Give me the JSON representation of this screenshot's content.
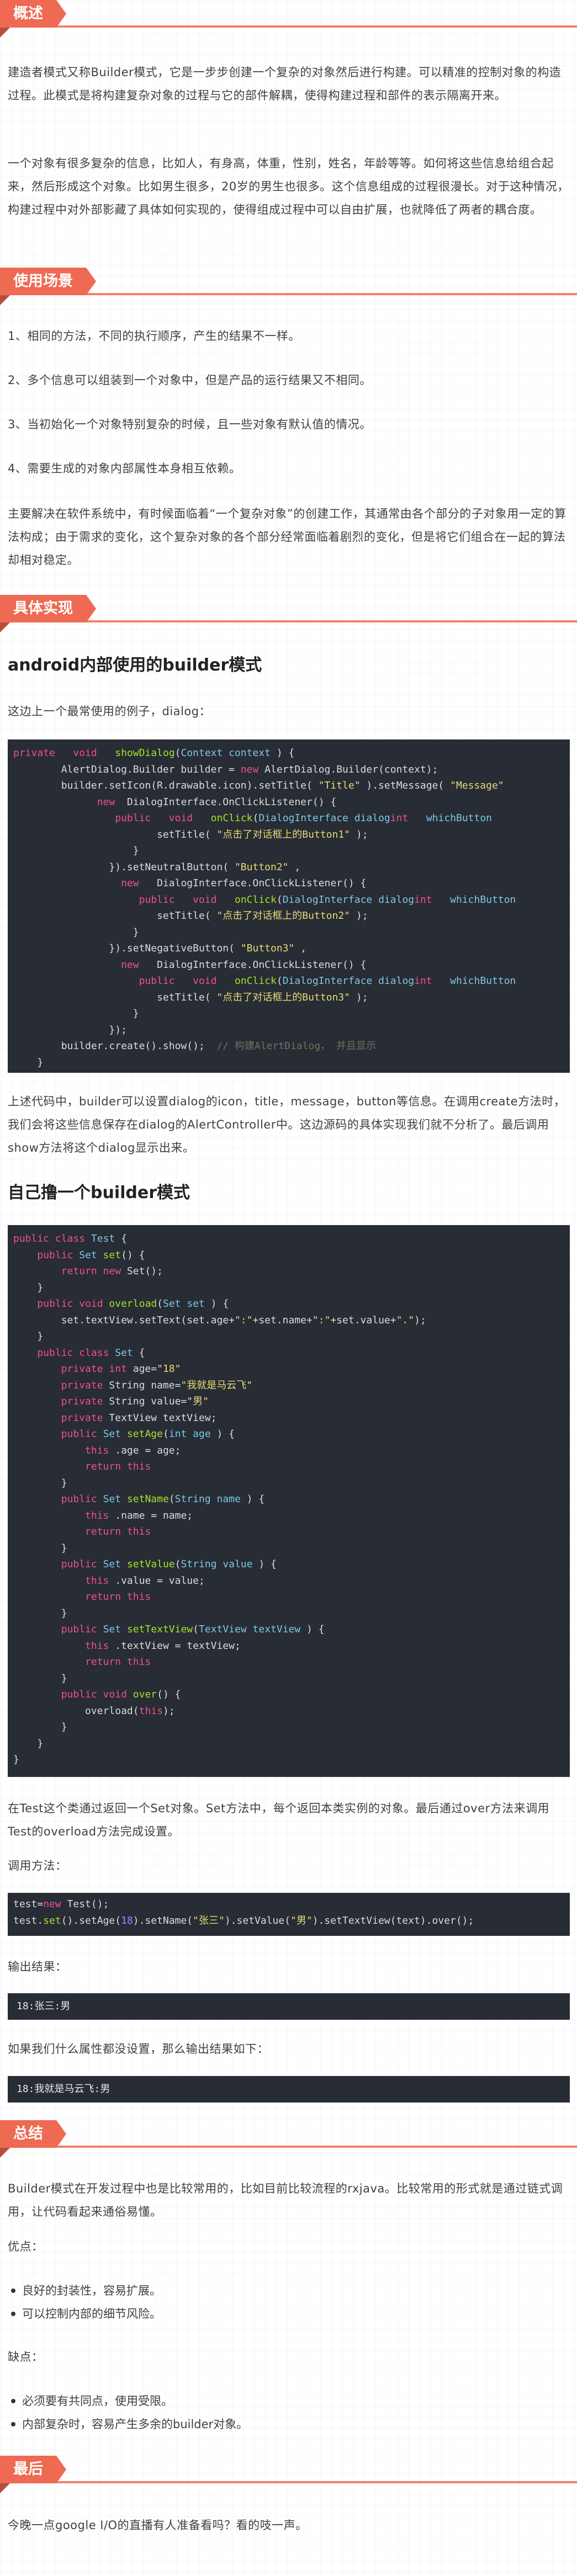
{
  "sections": {
    "overview": "概述",
    "scenarios": "使用场景",
    "impl": "具体实现",
    "summary": "总结",
    "last": "最后"
  },
  "overview": {
    "p1": "建造者模式又称Builder模式，它是一步步创建一个复杂的对象然后进行构建。可以精准的控制对象的构造过程。此模式是将构建复杂对象的过程与它的部件解耦，使得构建过程和部件的表示隔离开来。",
    "p2": "一个对象有很多复杂的信息，比如人，有身高，体重，性别，姓名，年龄等等。如何将这些信息给组合起来，然后形成这个对象。比如男生很多，20岁的男生也很多。这个信息组成的过程很漫长。对于这种情况，构建过程中对外部影藏了具体如何实现的，使得组成过程中可以自由扩展，也就降低了两者的耦合度。"
  },
  "scenarios": {
    "items": [
      "1、相同的方法，不同的执行顺序，产生的结果不一样。",
      "2、多个信息可以组装到一个对象中，但是产品的运行结果又不相同。",
      "3、当初始化一个对象特别复杂的时候，且一些对象有默认值的情况。",
      "4、需要生成的对象内部属性本身相互依赖。"
    ],
    "p": "主要解决在软件系统中，有时候面临着“一个复杂对象”的创建工作，其通常由各个部分的子对象用一定的算法构成；由于需求的变化，这个复杂对象的各个部分经常面临着剧烈的变化，但是将它们组合在一起的算法却相对稳定。"
  },
  "impl": {
    "h1": "android内部使用的builder模式",
    "p1": "这边上一个最常使用的例子，dialog：",
    "code1": [
      [
        [
          "k",
          "private"
        ],
        [
          "",
          "   "
        ],
        [
          "k",
          "void"
        ],
        [
          "",
          "   "
        ],
        [
          "f",
          "showDialog"
        ],
        [
          "",
          "("
        ],
        [
          "t",
          "Context context"
        ],
        [
          "",
          " ) {"
        ]
      ],
      [
        [
          "",
          "        AlertDialog.Builder builder = "
        ],
        [
          "k",
          "new"
        ],
        [
          "",
          " AlertDialog.Builder(context);"
        ]
      ],
      [
        [
          "",
          "        builder.setIcon(R.drawable.icon).setTitle( "
        ],
        [
          "s",
          "\"Title\""
        ],
        [
          "",
          " ).setMessage( "
        ],
        [
          "s",
          "\"Message\""
        ]
      ],
      [
        [
          "",
          "              "
        ],
        [
          "k",
          "new"
        ],
        [
          "",
          "  DialogInterface.OnClickListener() {"
        ]
      ],
      [
        [
          "",
          "                 "
        ],
        [
          "k",
          "public"
        ],
        [
          "",
          "   "
        ],
        [
          "k",
          "void"
        ],
        [
          "",
          "   "
        ],
        [
          "f",
          "onClick"
        ],
        [
          "",
          "("
        ],
        [
          "t",
          "DialogInterface dialog"
        ],
        [
          ",   "
        ],
        [
          "k",
          "int"
        ],
        [
          "",
          "   "
        ],
        [
          "t",
          "whichButton"
        ]
      ],
      [
        [
          "",
          "                        setTitle( "
        ],
        [
          "s",
          "\"点击了对话框上的Button1\""
        ],
        [
          "",
          " );"
        ]
      ],
      [
        [
          "",
          "                    }"
        ]
      ],
      [
        [
          "",
          "                }).setNeutralButton( "
        ],
        [
          "s",
          "\"Button2\""
        ],
        [
          "",
          " ,"
        ]
      ],
      [
        [
          "",
          "                  "
        ],
        [
          "k",
          "new"
        ],
        [
          "",
          "   DialogInterface.OnClickListener() {"
        ]
      ],
      [
        [
          "",
          "                     "
        ],
        [
          "k",
          "public"
        ],
        [
          "",
          "   "
        ],
        [
          "k",
          "void"
        ],
        [
          "",
          "   "
        ],
        [
          "f",
          "onClick"
        ],
        [
          "",
          "("
        ],
        [
          "t",
          "DialogInterface dialog"
        ],
        [
          ",   "
        ],
        [
          "k",
          "int"
        ],
        [
          "",
          "   "
        ],
        [
          "t",
          "whichButton"
        ]
      ],
      [
        [
          "",
          "                        setTitle( "
        ],
        [
          "s",
          "\"点击了对话框上的Button2\""
        ],
        [
          "",
          " );"
        ]
      ],
      [
        [
          "",
          "                    }"
        ]
      ],
      [
        [
          "",
          "                }).setNegativeButton( "
        ],
        [
          "s",
          "\"Button3\""
        ],
        [
          "",
          " ,"
        ]
      ],
      [
        [
          "",
          "                  "
        ],
        [
          "k",
          "new"
        ],
        [
          "",
          "   DialogInterface.OnClickListener() {"
        ]
      ],
      [
        [
          "",
          "                     "
        ],
        [
          "k",
          "public"
        ],
        [
          "",
          "   "
        ],
        [
          "k",
          "void"
        ],
        [
          "",
          "   "
        ],
        [
          "f",
          "onClick"
        ],
        [
          "",
          "("
        ],
        [
          "t",
          "DialogInterface dialog"
        ],
        [
          ",   "
        ],
        [
          "k",
          "int"
        ],
        [
          "",
          "   "
        ],
        [
          "t",
          "whichButton"
        ]
      ],
      [
        [
          "",
          "                        setTitle( "
        ],
        [
          "s",
          "\"点击了对话框上的Button3\""
        ],
        [
          "",
          " );"
        ]
      ],
      [
        [
          "",
          "                    }"
        ]
      ],
      [
        [
          "",
          "                });"
        ]
      ],
      [
        [
          "",
          "        builder.create().show();  "
        ],
        [
          "c",
          "// 构建AlertDialog， 并且显示"
        ]
      ],
      [
        [
          "",
          "    }"
        ]
      ]
    ],
    "p2": "上述代码中，builder可以设置dialog的icon，title，message，button等信息。在调用create方法时，我们会将这些信息保存在dialog的AlertController中。这边源码的具体实现我们就不分析了。最后调用show方法将这个dialog显示出来。",
    "h2": "自己撸一个builder模式",
    "code2": [
      [
        [
          "k",
          "public class"
        ],
        [
          "",
          " "
        ],
        [
          "t",
          "Test"
        ],
        [
          "",
          " {"
        ]
      ],
      [
        [
          "",
          "    "
        ],
        [
          "k",
          "public"
        ],
        [
          "",
          " "
        ],
        [
          "t",
          "Set"
        ],
        [
          "",
          " "
        ],
        [
          "f",
          "set"
        ],
        [
          "",
          "() {"
        ]
      ],
      [
        [
          "",
          "        "
        ],
        [
          "k",
          "return new"
        ],
        [
          "",
          " Set();"
        ]
      ],
      [
        [
          "",
          "    }"
        ]
      ],
      [
        [
          "",
          "    "
        ],
        [
          "k",
          "public void"
        ],
        [
          "",
          " "
        ],
        [
          "f",
          "overload"
        ],
        [
          "",
          "("
        ],
        [
          "t",
          "Set set"
        ],
        [
          "",
          " ) {"
        ]
      ],
      [
        [
          "",
          "        set.textView.setText(set.age+"
        ],
        [
          "s",
          "\":\""
        ],
        [
          "",
          "+set.name+"
        ],
        [
          "s",
          "\":\""
        ],
        [
          "",
          "+set.value+"
        ],
        [
          "s",
          "\".\""
        ],
        [
          "",
          ");"
        ]
      ],
      [
        [
          "",
          "    }"
        ]
      ],
      [
        [
          "",
          "    "
        ],
        [
          "k",
          "public class"
        ],
        [
          "",
          " "
        ],
        [
          "t",
          "Set"
        ],
        [
          "",
          " {"
        ]
      ],
      [
        [
          "",
          "        "
        ],
        [
          "k",
          "private int"
        ],
        [
          "",
          " age="
        ],
        [
          "s",
          "\"18\""
        ],
        [
          ";"
        ]
      ],
      [
        [
          "",
          "        "
        ],
        [
          "k",
          "private"
        ],
        [
          "",
          " String name="
        ],
        [
          "s",
          "\"我就是马云飞\""
        ],
        [
          ";"
        ]
      ],
      [
        [
          "",
          "        "
        ],
        [
          "k",
          "private"
        ],
        [
          "",
          " String value="
        ],
        [
          "s",
          "\"男\""
        ],
        [
          ";"
        ]
      ],
      [
        [
          "",
          "        "
        ],
        [
          "k",
          "private"
        ],
        [
          "",
          " TextView textView;"
        ]
      ],
      [
        [
          "",
          "        "
        ],
        [
          "k",
          "public"
        ],
        [
          "",
          " "
        ],
        [
          "t",
          "Set"
        ],
        [
          "",
          " "
        ],
        [
          "f",
          "setAge"
        ],
        [
          "",
          "("
        ],
        [
          "t",
          "int age"
        ],
        [
          "",
          " ) {"
        ]
      ],
      [
        [
          "",
          "            "
        ],
        [
          "k",
          "this"
        ],
        [
          "",
          " .age = age;"
        ]
      ],
      [
        [
          "",
          "            "
        ],
        [
          "k",
          "return this"
        ],
        [
          ";"
        ]
      ],
      [
        [
          "",
          "        }"
        ]
      ],
      [
        [
          "",
          "        "
        ],
        [
          "k",
          "public"
        ],
        [
          "",
          " "
        ],
        [
          "t",
          "Set"
        ],
        [
          "",
          " "
        ],
        [
          "f",
          "setName"
        ],
        [
          "",
          "("
        ],
        [
          "t",
          "String name"
        ],
        [
          "",
          " ) {"
        ]
      ],
      [
        [
          "",
          "            "
        ],
        [
          "k",
          "this"
        ],
        [
          "",
          " .name = name;"
        ]
      ],
      [
        [
          "",
          "            "
        ],
        [
          "k",
          "return this"
        ],
        [
          ";"
        ]
      ],
      [
        [
          "",
          "        }"
        ]
      ],
      [
        [
          "",
          "        "
        ],
        [
          "k",
          "public"
        ],
        [
          "",
          " "
        ],
        [
          "t",
          "Set"
        ],
        [
          "",
          " "
        ],
        [
          "f",
          "setValue"
        ],
        [
          "",
          "("
        ],
        [
          "t",
          "String value"
        ],
        [
          "",
          " ) {"
        ]
      ],
      [
        [
          "",
          "            "
        ],
        [
          "k",
          "this"
        ],
        [
          "",
          " .value = value;"
        ]
      ],
      [
        [
          "",
          "            "
        ],
        [
          "k",
          "return this"
        ],
        [
          ";"
        ]
      ],
      [
        [
          "",
          "        }"
        ]
      ],
      [
        [
          "",
          "        "
        ],
        [
          "k",
          "public"
        ],
        [
          "",
          " "
        ],
        [
          "t",
          "Set"
        ],
        [
          "",
          " "
        ],
        [
          "f",
          "setTextView"
        ],
        [
          "",
          "("
        ],
        [
          "t",
          "TextView textView"
        ],
        [
          "",
          " ) {"
        ]
      ],
      [
        [
          "",
          "            "
        ],
        [
          "k",
          "this"
        ],
        [
          "",
          " .textView = textView;"
        ]
      ],
      [
        [
          "",
          "            "
        ],
        [
          "k",
          "return this"
        ],
        [
          ";"
        ]
      ],
      [
        [
          "",
          "        }"
        ]
      ],
      [
        [
          "",
          "        "
        ],
        [
          "k",
          "public void"
        ],
        [
          "",
          " "
        ],
        [
          "f",
          "over"
        ],
        [
          "",
          "() {"
        ]
      ],
      [
        [
          "",
          "            overload("
        ],
        [
          "k",
          "this"
        ],
        [
          "",
          ");"
        ]
      ],
      [
        [
          "",
          "        }"
        ]
      ],
      [
        [
          "",
          "    }"
        ]
      ],
      [
        [
          "",
          "}"
        ]
      ]
    ],
    "p3": "在Test这个类通过返回一个Set对象。Set方法中，每个返回本类实例的对象。最后通过over方法来调用Test的overload方法完成设置。",
    "p4": "调用方法：",
    "code3": [
      [
        [
          "",
          "test="
        ],
        [
          "k",
          "new"
        ],
        [
          "",
          " Test();"
        ]
      ],
      [
        [
          "",
          "test."
        ],
        [
          "f",
          "set"
        ],
        [
          "",
          "().setAge("
        ],
        [
          "n",
          "18"
        ],
        [
          "",
          ").setName("
        ],
        [
          "s",
          "\"张三\""
        ],
        [
          "",
          ").setValue("
        ],
        [
          "s",
          "\"男\""
        ],
        [
          "",
          ").setTextView(text).over();"
        ]
      ]
    ],
    "p5": "输出结果：",
    "out1": "18:张三:男",
    "p6": "如果我们什么属性都没设置，那么输出结果如下：",
    "out2": "18:我就是马云飞:男"
  },
  "summary": {
    "p1": "Builder模式在开发过程中也是比较常用的，比如目前比较流程的rxjava。比较常用的形式就是通过链式调用，让代码看起来通俗易懂。",
    "adv": "优点：",
    "adv_items": [
      "良好的封装性，容易扩展。",
      "可以控制内部的细节风险。"
    ],
    "dis": "缺点：",
    "dis_items": [
      "必须要有共同点，使用受限。",
      "内部复杂时，容易产生多余的builder对象。"
    ]
  },
  "last": {
    "p": "今晚一点google I/O的直播有人准备看吗？看的吱一声。"
  }
}
